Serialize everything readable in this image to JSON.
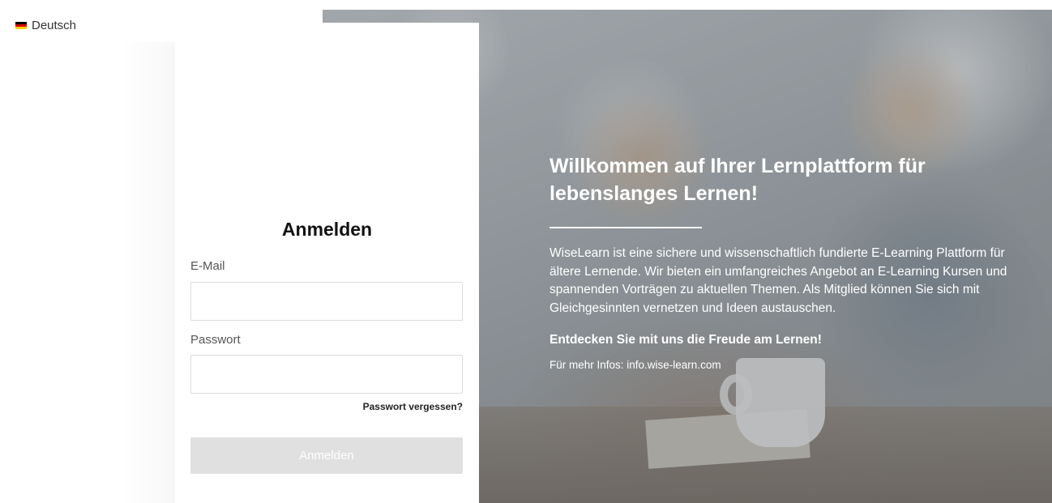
{
  "language": {
    "selected": "Deutsch",
    "flag_colors": [
      "#000000",
      "#dd0000",
      "#ffce00"
    ]
  },
  "login": {
    "title": "Anmelden",
    "email_label": "E-Mail",
    "email_value": "",
    "password_label": "Passwort",
    "password_value": "",
    "forgot_link": "Passwort vergessen?",
    "submit_label": "Anmelden",
    "submit_color": "#e0e0e0"
  },
  "hero": {
    "title": "Willkommen auf Ihrer Lernplattform für lebenslanges Lernen!",
    "description": "WiseLearn ist eine sichere und wissenschaftlich fundierte E-Learning Plattform für ältere Lernende. Wir bieten ein umfangreiches Angebot an E-Learning Kursen und spannenden Vorträgen zu aktuellen Themen. Als Mitglied können Sie sich mit Gleichgesinnten vernetzen und Ideen austauschen.",
    "cta": "Entdecken Sie mit uns die Freude am Lernen!",
    "info": "Für mehr Infos: info.wise-learn.com"
  }
}
